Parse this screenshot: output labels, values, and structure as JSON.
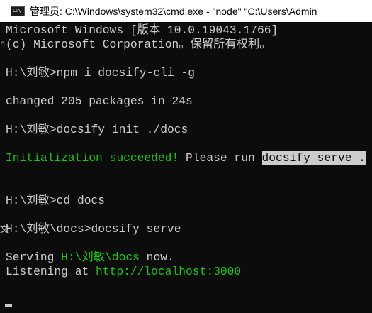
{
  "window": {
    "title": "管理员: C:\\Windows\\system32\\cmd.exe  - \"node\"   \"C:\\Users\\Admin",
    "icon": "cmd-console-icon",
    "icon_glyph": "C:\\"
  },
  "console": {
    "lines": [
      "Microsoft Windows [版本 10.0.19043.1766]",
      "(c) Microsoft Corporation。保留所有权利。",
      "",
      "H:\\刘敏>npm i docsify-cli -g",
      "",
      "changed 205 packages in 24s",
      "",
      "H:\\刘敏>docsify init ./docs",
      "",
      {
        "init_ok": "Initialization succeeded!",
        "please_run": " Please run ",
        "serve_cmd": "docsify serve ."
      },
      "",
      "",
      "H:\\刘敏>cd docs",
      "",
      "H:\\刘敏\\docs>docsify serve",
      "",
      {
        "serving_prefix": "Serving ",
        "serving_path": "H:\\刘敏\\docs",
        "serving_suffix": " now."
      },
      {
        "listening_prefix": "Listening at ",
        "listening_url": "http://localhost:3000"
      }
    ],
    "stray_left": [
      "n",
      "文"
    ]
  },
  "colors": {
    "background": "#0c0c0c",
    "foreground": "#cccccc",
    "success_green": "#16c60c",
    "selection": "#cccccc"
  }
}
